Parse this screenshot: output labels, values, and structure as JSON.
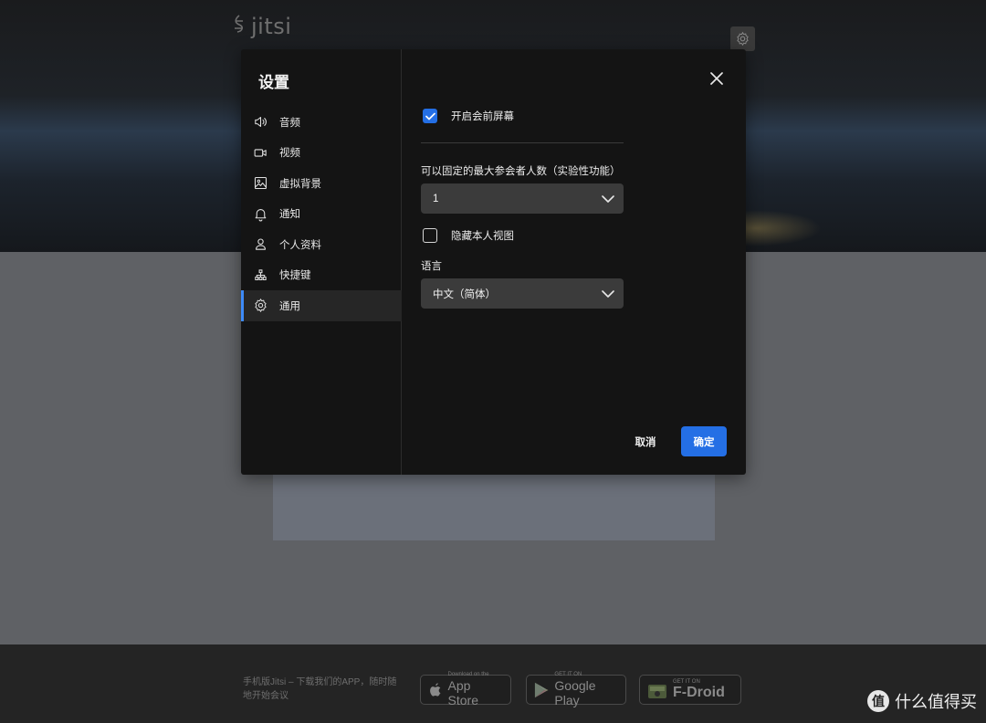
{
  "background": {
    "logo_text": "jitsi",
    "footer_text": "手机版Jitsi – 下载我们的APP，随时随地开始会议",
    "stores": [
      {
        "small": "Download on the",
        "big": "App Store",
        "icon": "apple-icon"
      },
      {
        "small": "GET IT ON",
        "big": "Google Play",
        "icon": "google-play-icon"
      },
      {
        "small": "GET IT ON",
        "big": "F-Droid",
        "icon": "fdroid-icon"
      }
    ]
  },
  "watermark": {
    "badge": "值",
    "text": "什么值得买"
  },
  "modal": {
    "title": "设置",
    "nav": [
      {
        "label": "音频",
        "icon": "speaker-icon"
      },
      {
        "label": "视频",
        "icon": "camera-icon"
      },
      {
        "label": "虚拟背景",
        "icon": "image-icon"
      },
      {
        "label": "通知",
        "icon": "bell-icon"
      },
      {
        "label": "个人资料",
        "icon": "user-icon"
      },
      {
        "label": "快捷键",
        "icon": "shortcut-icon"
      },
      {
        "label": "通用",
        "icon": "gear-icon",
        "active": true
      }
    ],
    "general": {
      "prejoin_label": "开启会前屏幕",
      "prejoin_checked": true,
      "max_pinned_label": "可以固定的最大参会者人数（实验性功能）",
      "max_pinned_value": "1",
      "hide_self_label": "隐藏本人视图",
      "hide_self_checked": false,
      "language_label": "语言",
      "language_value": "中文（简体）"
    },
    "buttons": {
      "cancel": "取消",
      "ok": "确定"
    }
  },
  "colors": {
    "accent": "#246fe5",
    "active_bar": "#3d8af7",
    "modal_bg": "#141414"
  }
}
